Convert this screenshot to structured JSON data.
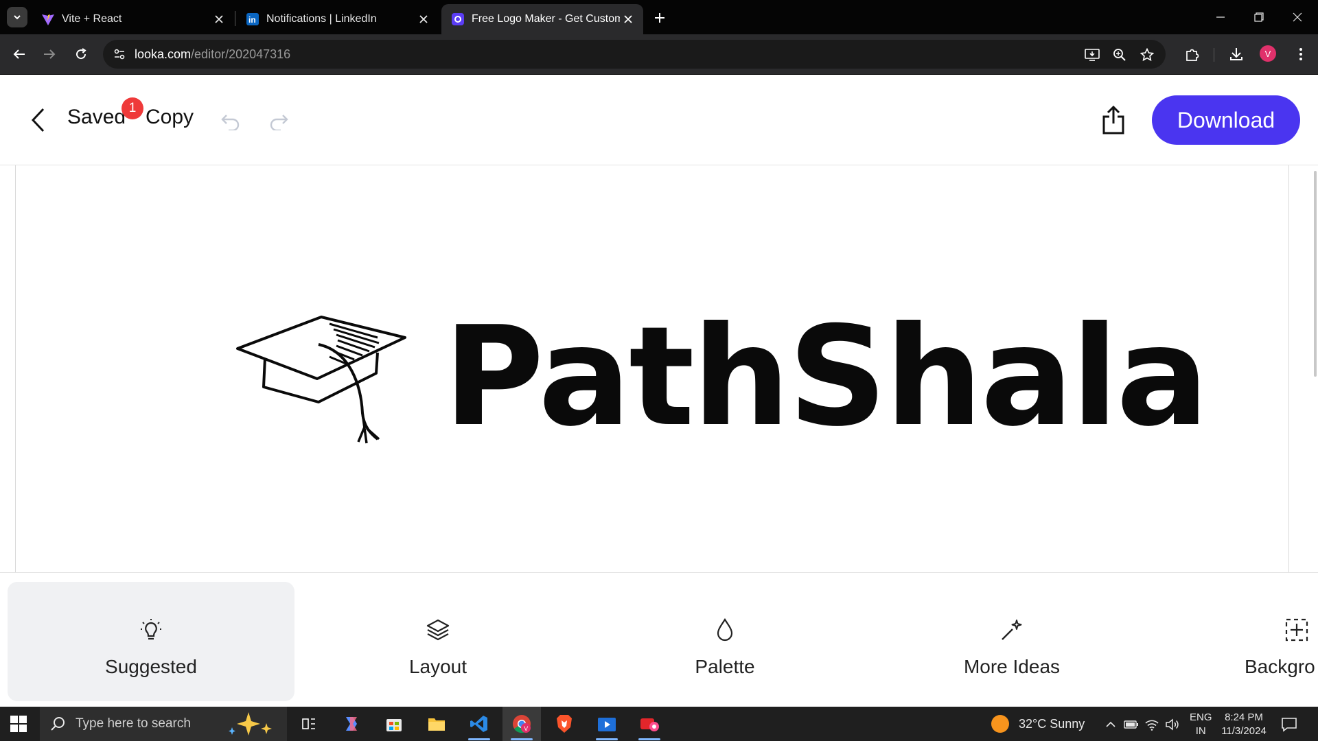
{
  "browser": {
    "tabs": [
      {
        "title": "Vite + React",
        "favicon": "vite-icon"
      },
      {
        "title": "Notifications | LinkedIn",
        "favicon": "linkedin-icon"
      },
      {
        "title": "Free Logo Maker - Get Custom",
        "favicon": "looka-icon",
        "active": true
      }
    ],
    "url_host": "looka.com",
    "url_path": "/editor/202047316",
    "profile_initial": "V"
  },
  "editor": {
    "saved_label": "Saved",
    "badge_count": "1",
    "copy_label": "Copy",
    "download_label": "Download"
  },
  "logo": {
    "text": "PathShala",
    "icon": "graduation-cap-icon"
  },
  "tools": [
    {
      "label": "Suggested",
      "icon": "lightbulb-icon",
      "active": true
    },
    {
      "label": "Layout",
      "icon": "layers-icon"
    },
    {
      "label": "Palette",
      "icon": "droplet-icon"
    },
    {
      "label": "More Ideas",
      "icon": "magic-wand-icon"
    },
    {
      "label": "Backgro",
      "icon": "background-grid-icon"
    }
  ],
  "taskbar": {
    "search_placeholder": "Type here to search",
    "weather": "32°C  Sunny",
    "lang_top": "ENG",
    "lang_bottom": "IN",
    "time": "8:24 PM",
    "date": "11/3/2024"
  },
  "colors": {
    "accent": "#4a35f0",
    "badge": "#ef3a3a",
    "profile": "#e0316b"
  }
}
